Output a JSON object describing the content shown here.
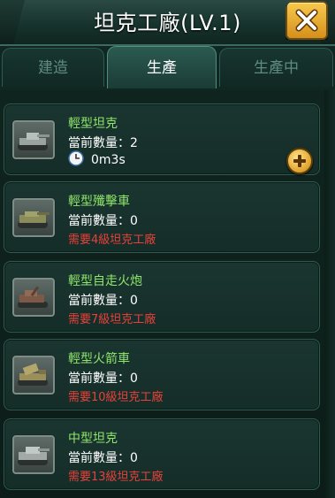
{
  "header": {
    "title": "坦克工廠(LV.1)"
  },
  "tabs": [
    {
      "label": "建造",
      "active": false
    },
    {
      "label": "生產",
      "active": true
    },
    {
      "label": "生產中",
      "active": false
    }
  ],
  "units": [
    {
      "name": "輕型坦克",
      "quantity": "當前數量：2",
      "time": "0m3s",
      "icon": "light-tank-icon"
    },
    {
      "name": "輕型殲擊車",
      "quantity": "當前數量：0",
      "requirement": "需要4級坦克工廠",
      "icon": "light-destroyer-icon"
    },
    {
      "name": "輕型自走火炮",
      "quantity": "當前數量：0",
      "requirement": "需要7級坦克工廠",
      "icon": "self-propelled-artillery-icon"
    },
    {
      "name": "輕型火箭車",
      "quantity": "當前數量：0",
      "requirement": "需要10級坦克工廠",
      "icon": "rocket-launcher-icon"
    },
    {
      "name": "中型坦克",
      "quantity": "當前數量：0",
      "requirement": "需要13級坦克工廠",
      "icon": "medium-tank-icon"
    }
  ],
  "colors": {
    "name": "#8fe66a",
    "requirement": "#e8413a",
    "accent": "#e0a12b"
  }
}
